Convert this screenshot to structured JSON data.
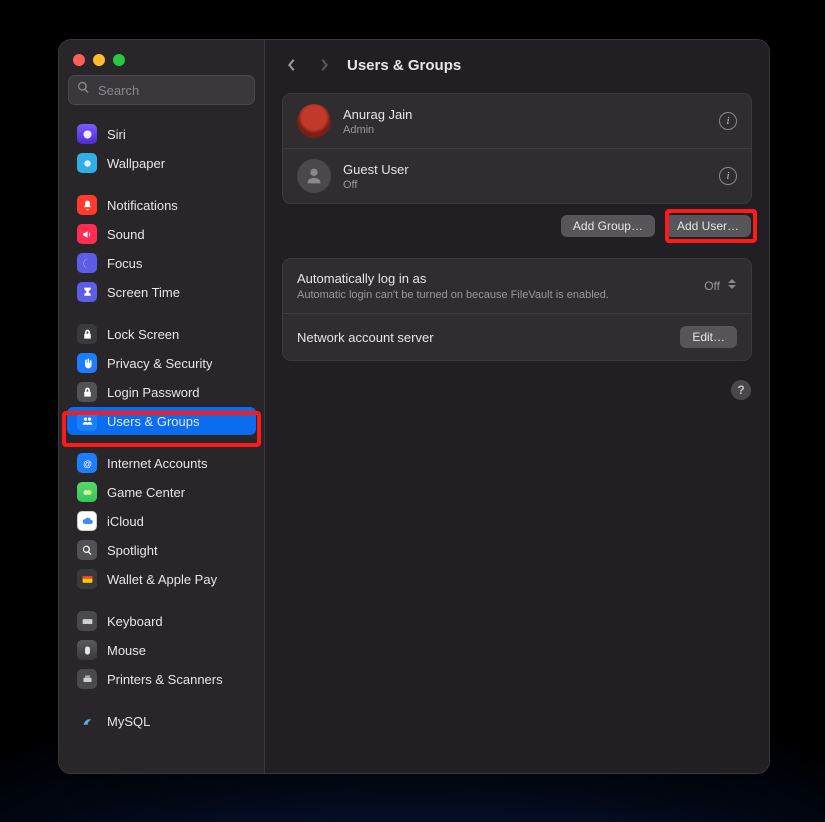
{
  "traffic": {
    "close": "close",
    "min": "minimize",
    "max": "maximize"
  },
  "search": {
    "placeholder": "Search"
  },
  "sidebar": {
    "groups": [
      {
        "items": [
          {
            "label": "Siri"
          },
          {
            "label": "Wallpaper"
          }
        ]
      },
      {
        "items": [
          {
            "label": "Notifications"
          },
          {
            "label": "Sound"
          },
          {
            "label": "Focus"
          },
          {
            "label": "Screen Time"
          }
        ]
      },
      {
        "items": [
          {
            "label": "Lock Screen"
          },
          {
            "label": "Privacy & Security"
          },
          {
            "label": "Login Password"
          },
          {
            "label": "Users & Groups",
            "selected": true
          }
        ]
      },
      {
        "items": [
          {
            "label": "Internet Accounts"
          },
          {
            "label": "Game Center"
          },
          {
            "label": "iCloud"
          },
          {
            "label": "Spotlight"
          },
          {
            "label": "Wallet & Apple Pay"
          }
        ]
      },
      {
        "items": [
          {
            "label": "Keyboard"
          },
          {
            "label": "Mouse"
          },
          {
            "label": "Printers & Scanners"
          }
        ]
      },
      {
        "items": [
          {
            "label": "MySQL"
          }
        ]
      }
    ]
  },
  "header": {
    "title": "Users & Groups"
  },
  "users": [
    {
      "name": "Anurag Jain",
      "role": "Admin",
      "avatar": "custom"
    },
    {
      "name": "Guest User",
      "role": "Off",
      "avatar": "generic"
    }
  ],
  "buttons": {
    "add_group": "Add Group…",
    "add_user": "Add User…",
    "edit": "Edit…"
  },
  "autologin": {
    "title": "Automatically log in as",
    "note": "Automatic login can't be turned on because FileVault is enabled.",
    "value": "Off"
  },
  "network": {
    "title": "Network account server"
  },
  "help": {
    "label": "?"
  }
}
